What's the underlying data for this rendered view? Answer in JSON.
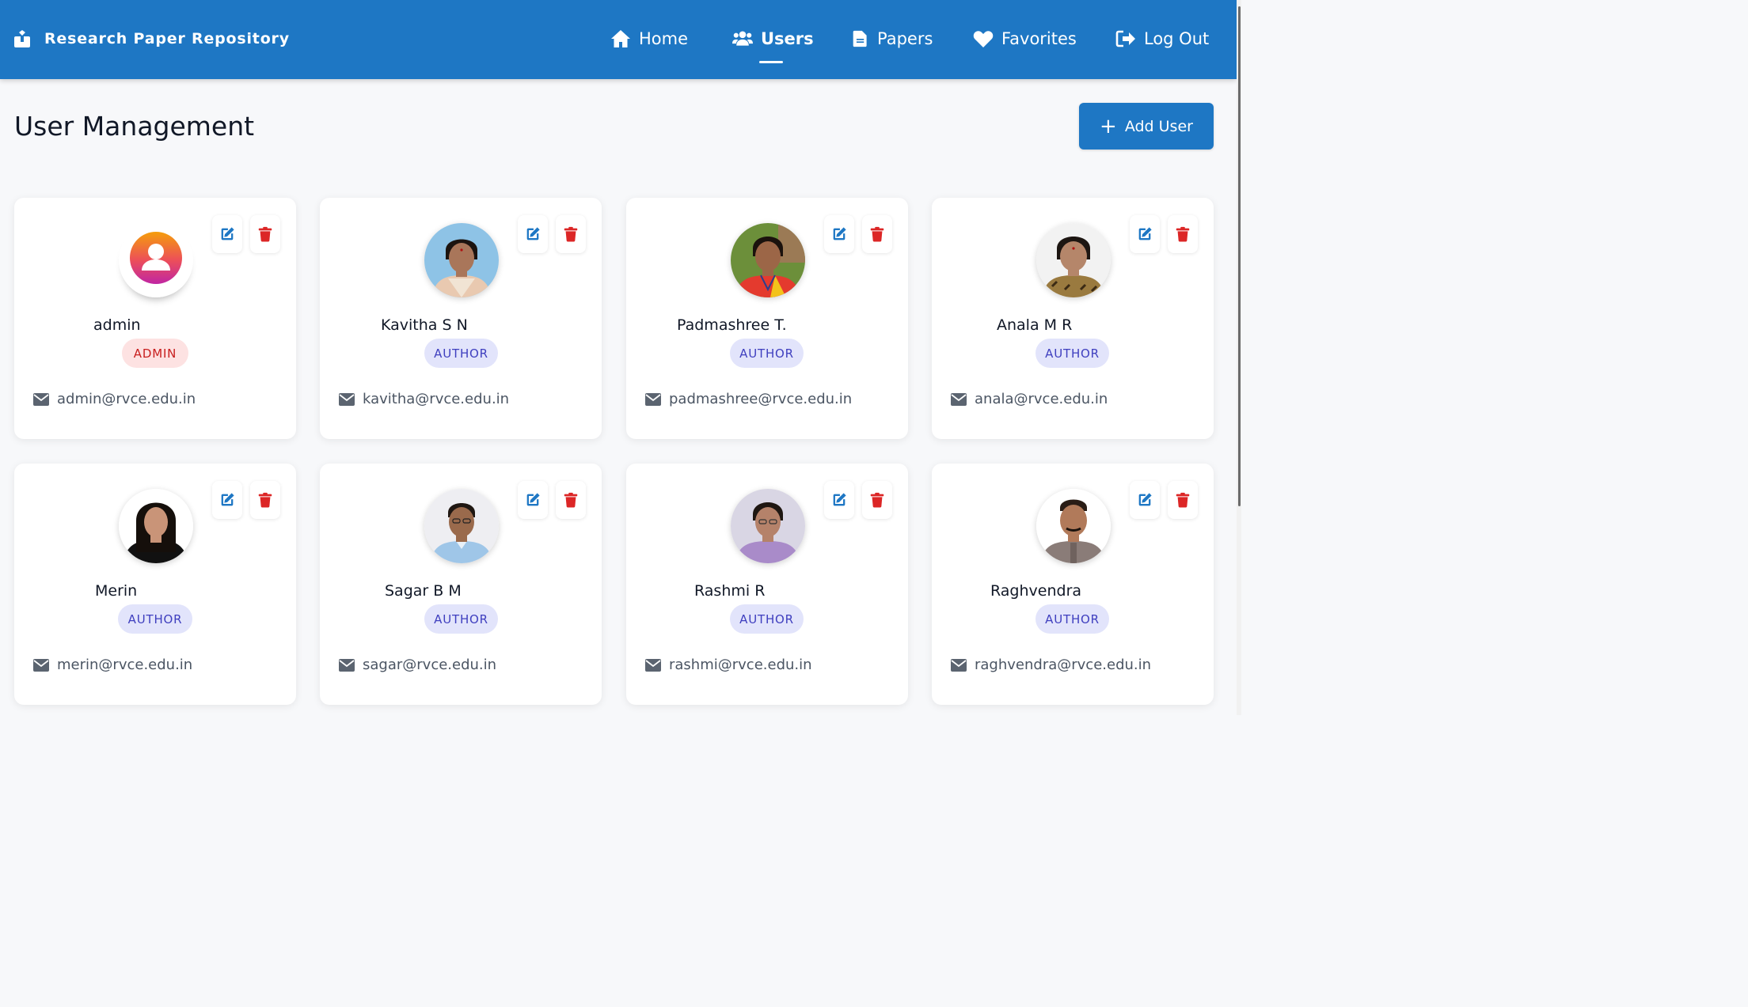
{
  "app": {
    "title": "Research Paper Repository"
  },
  "nav": {
    "home": "Home",
    "users": "Users",
    "papers": "Papers",
    "favorites": "Favorites",
    "logout": "Log Out"
  },
  "page": {
    "title": "User Management",
    "add_user": "Add User"
  },
  "colors": {
    "primary": "#1e77c4",
    "danger": "#dc2626",
    "admin_badge": "#fde2e2",
    "author_badge": "#e2e4fb"
  },
  "users": [
    {
      "name": "admin",
      "role": "ADMIN",
      "email": "admin@rvce.edu.in"
    },
    {
      "name": "Kavitha S N",
      "role": "AUTHOR",
      "email": "kavitha@rvce.edu.in"
    },
    {
      "name": "Padmashree T.",
      "role": "AUTHOR",
      "email": "padmashree@rvce.edu.in"
    },
    {
      "name": "Anala M R",
      "role": "AUTHOR",
      "email": "anala@rvce.edu.in"
    },
    {
      "name": "Merin",
      "role": "AUTHOR",
      "email": "merin@rvce.edu.in"
    },
    {
      "name": "Sagar B M",
      "role": "AUTHOR",
      "email": "sagar@rvce.edu.in"
    },
    {
      "name": "Rashmi R",
      "role": "AUTHOR",
      "email": "rashmi@rvce.edu.in"
    },
    {
      "name": "Raghvendra",
      "role": "AUTHOR",
      "email": "raghvendra@rvce.edu.in"
    }
  ]
}
